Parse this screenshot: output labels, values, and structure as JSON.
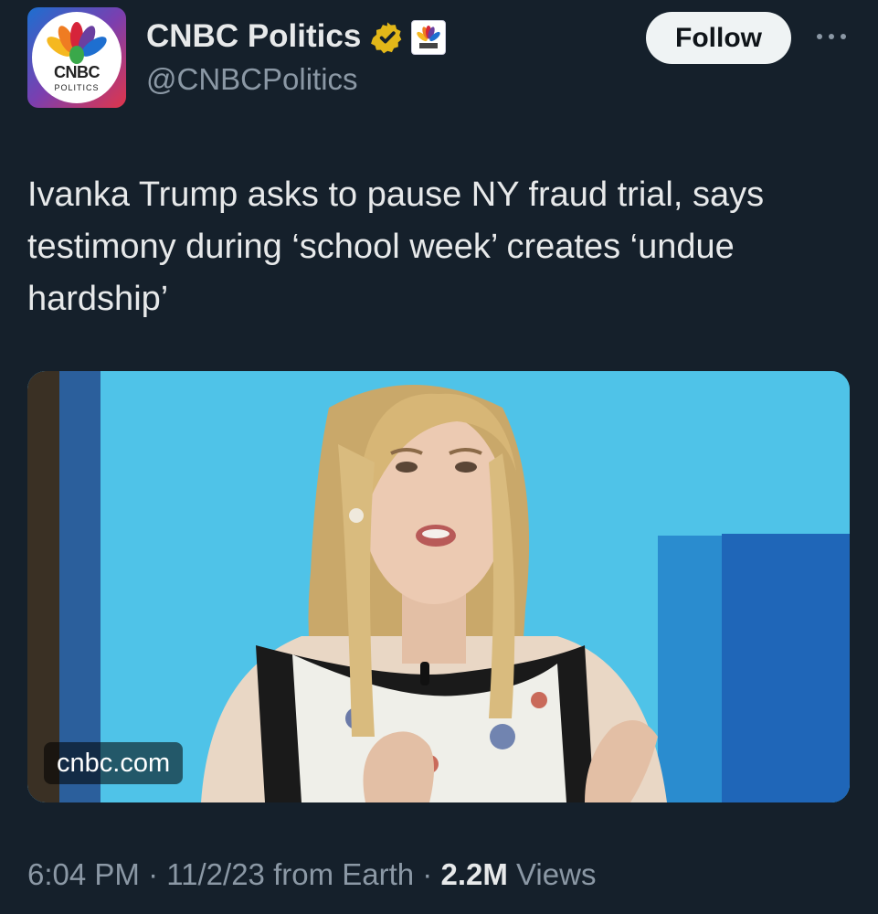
{
  "account": {
    "display_name": "CNBC Politics",
    "handle": "@CNBCPolitics",
    "avatar_text": "CNBC",
    "avatar_subtext": "POLITICS",
    "verified_badge_color": "#e2b719",
    "follow_label": "Follow",
    "more_icon": "more-horizontal-icon"
  },
  "tweet": {
    "text": "Ivanka Trump asks to pause NY fraud trial, says testimony during ‘school week’ creates ‘undue hardship’",
    "media": {
      "source_label": "cnbc.com"
    },
    "time": "6:04 PM",
    "separator": "·",
    "date": "11/2/23",
    "location": "from Earth",
    "views_count": "2.2M",
    "views_label": "Views"
  },
  "colors": {
    "background": "#15202b",
    "text_primary": "#e7e9ea",
    "text_secondary": "#8b98a5",
    "follow_bg": "#eff3f4"
  }
}
